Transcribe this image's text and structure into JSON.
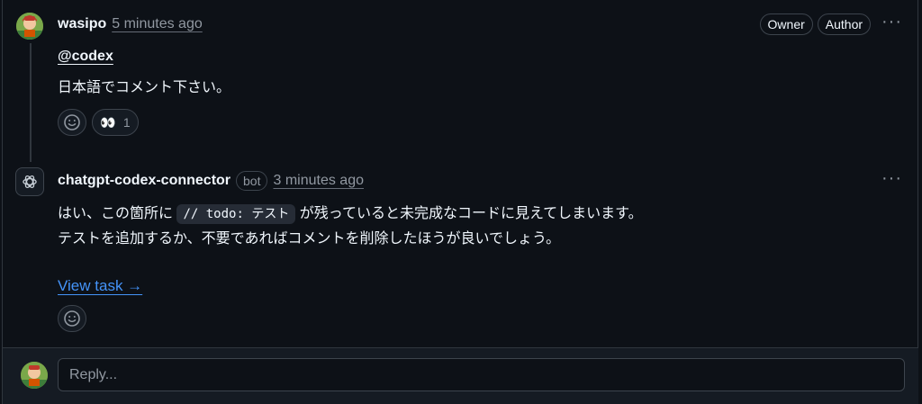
{
  "comments": [
    {
      "author": "wasipo",
      "time": "5 minutes ago",
      "badges": [
        "Owner",
        "Author"
      ],
      "mention": "@codex",
      "body": "日本語でコメント下さい。",
      "reaction": {
        "emoji": "👀",
        "count": "1"
      }
    },
    {
      "author": "chatgpt-codex-connector",
      "bot_label": "bot",
      "time": "3 minutes ago",
      "line1_before": "はい、この箇所に",
      "line1_code": "// todo: テスト",
      "line1_after": "が残っていると未完成なコードに見えてしまいます。",
      "line2": "テストを追加するか、不要であればコメントを削除したほうが良いでしょう。",
      "link": "View task →"
    }
  ],
  "menu_icon": "···",
  "reply": {
    "placeholder": "Reply..."
  }
}
